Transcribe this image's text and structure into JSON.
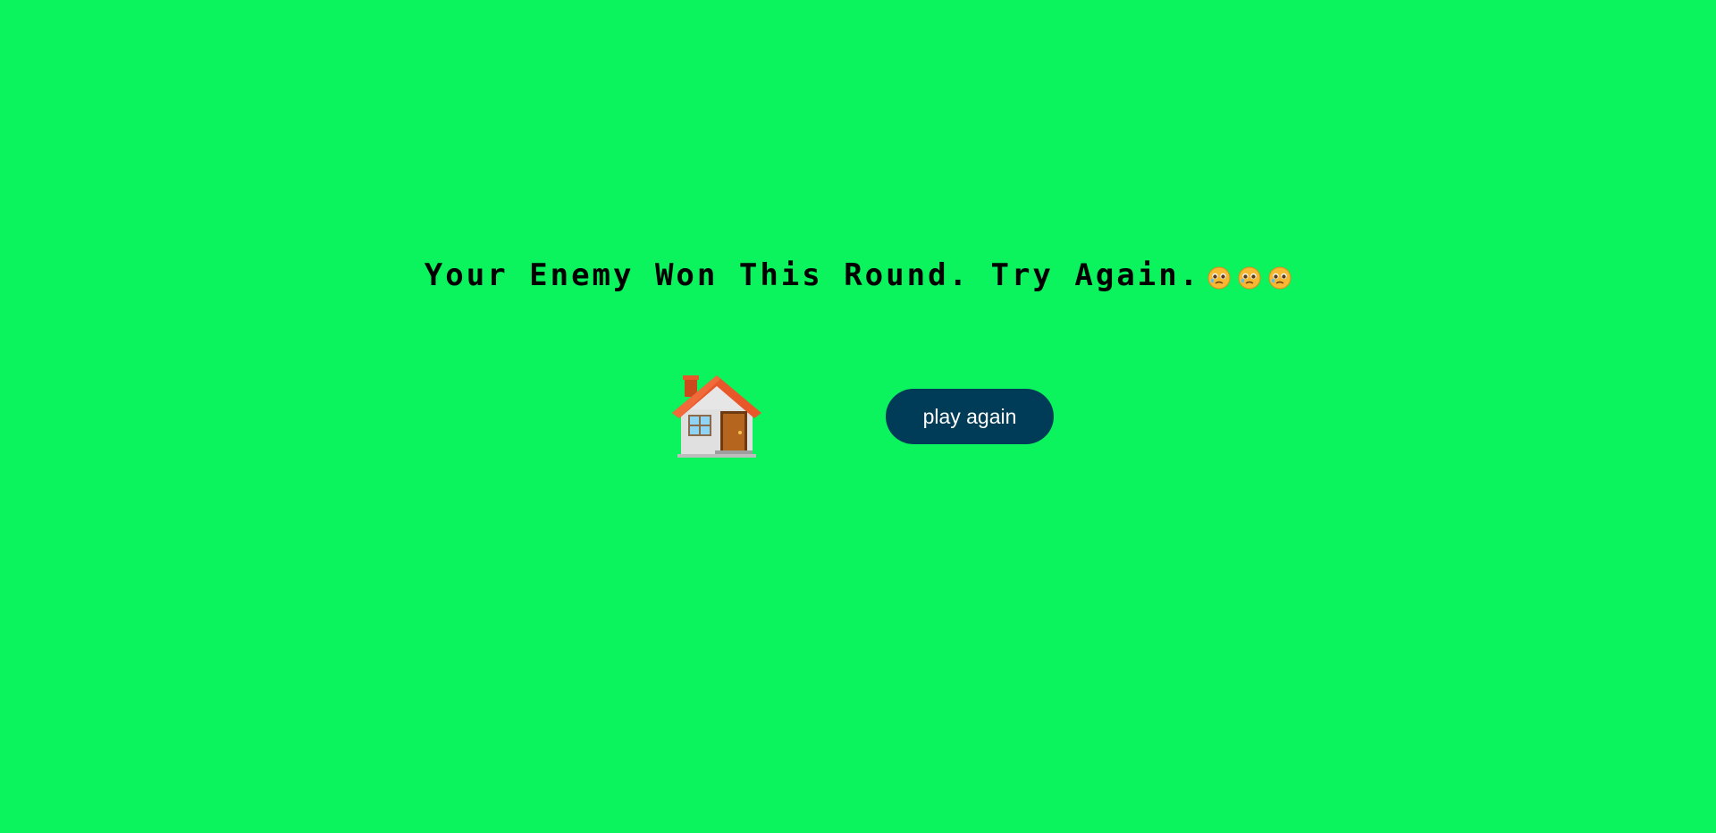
{
  "message": {
    "text": "Your Enemy Won This Round. Try Again.",
    "emoji_icons": [
      "pleading-face-icon",
      "pleading-face-icon",
      "pleading-face-icon"
    ]
  },
  "home": {
    "icon": "house-icon"
  },
  "play_again": {
    "label": "play again"
  },
  "colors": {
    "background": "#0bf35d",
    "button": "#003b57",
    "button_text": "#ffffff",
    "text": "#000000"
  }
}
